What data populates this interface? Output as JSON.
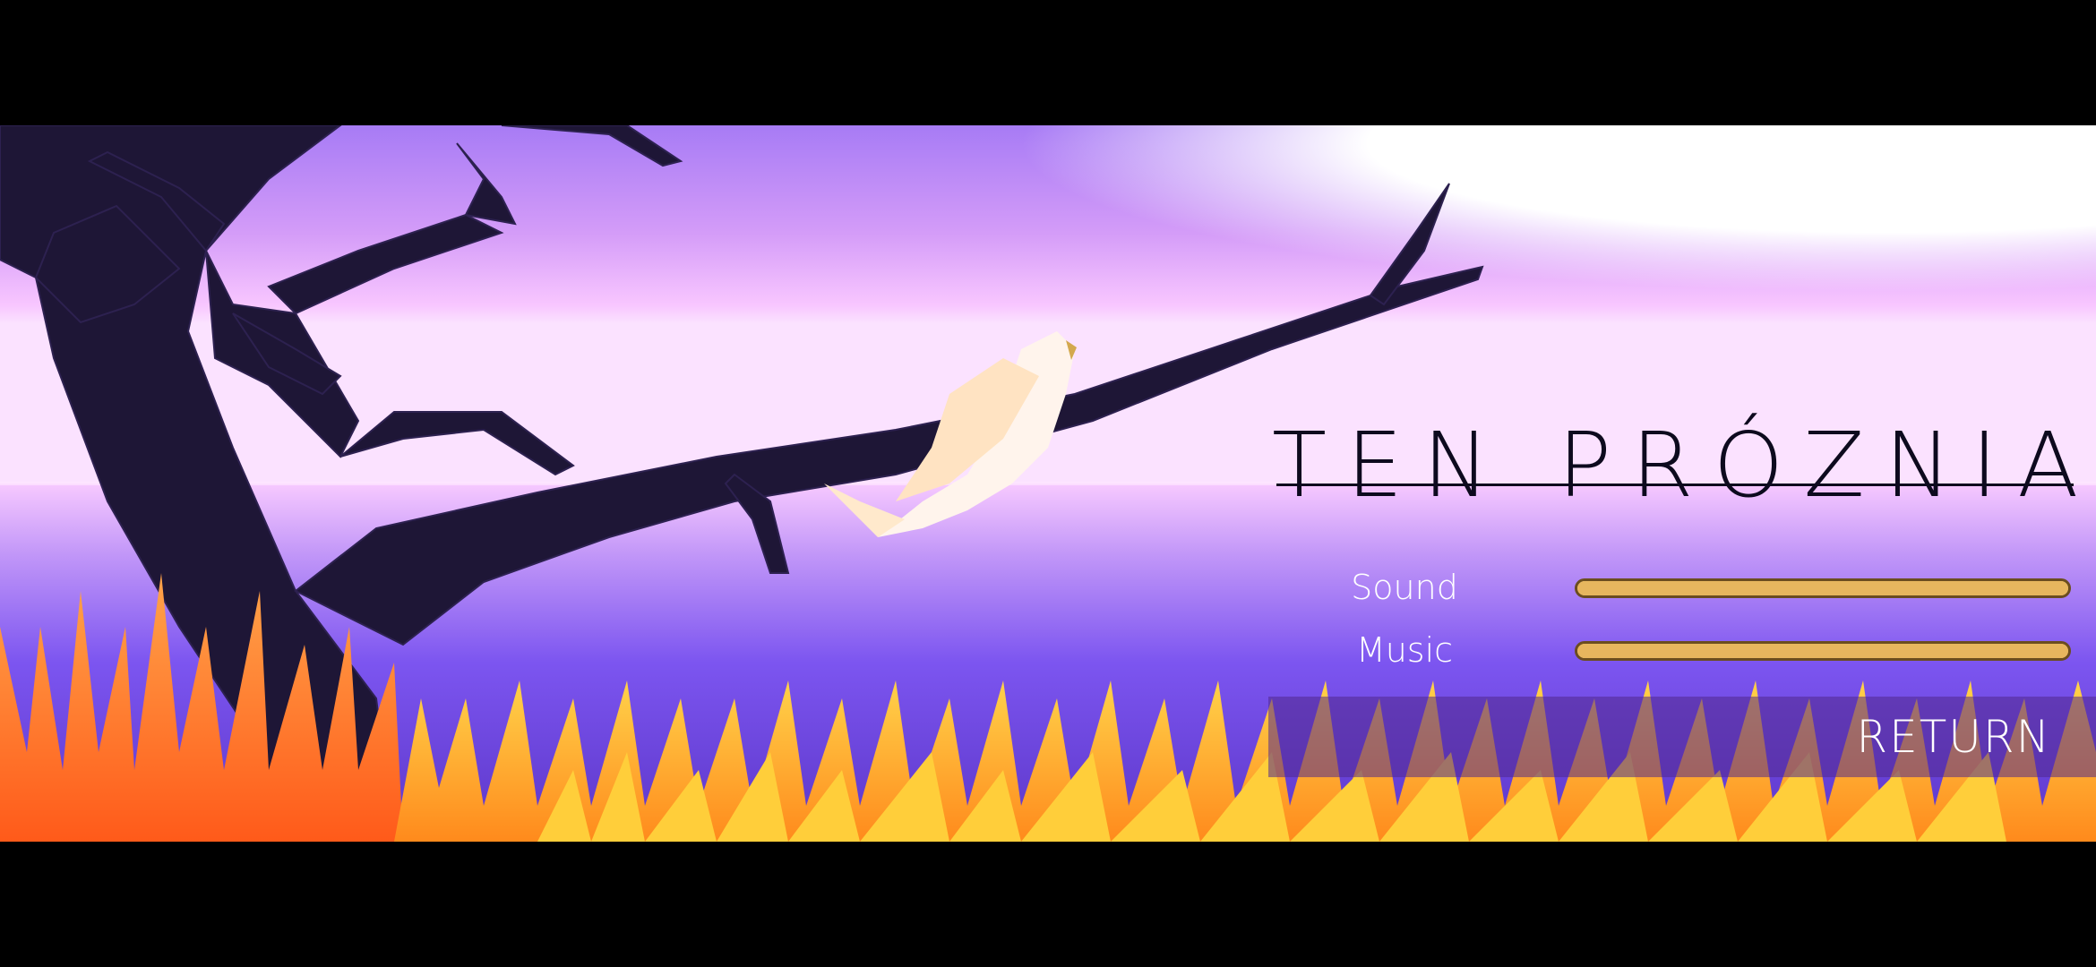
{
  "game": {
    "title": "TEN PRÓZNIA"
  },
  "settings": {
    "sound": {
      "label": "Sound",
      "level": 1.0
    },
    "music": {
      "label": "Music",
      "level": 1.0
    }
  },
  "menu": {
    "return_label": "RETURN"
  },
  "colors": {
    "slider_fill": "#e7b65e",
    "slider_border": "#6b4d1f",
    "tree": "#1e1636",
    "grass_light": "#ffc33a",
    "grass_dark": "#ff6a1a",
    "sky_top": "#a77bf5",
    "sky_horizon": "#f8c6ff",
    "water": "#7c55f0"
  }
}
